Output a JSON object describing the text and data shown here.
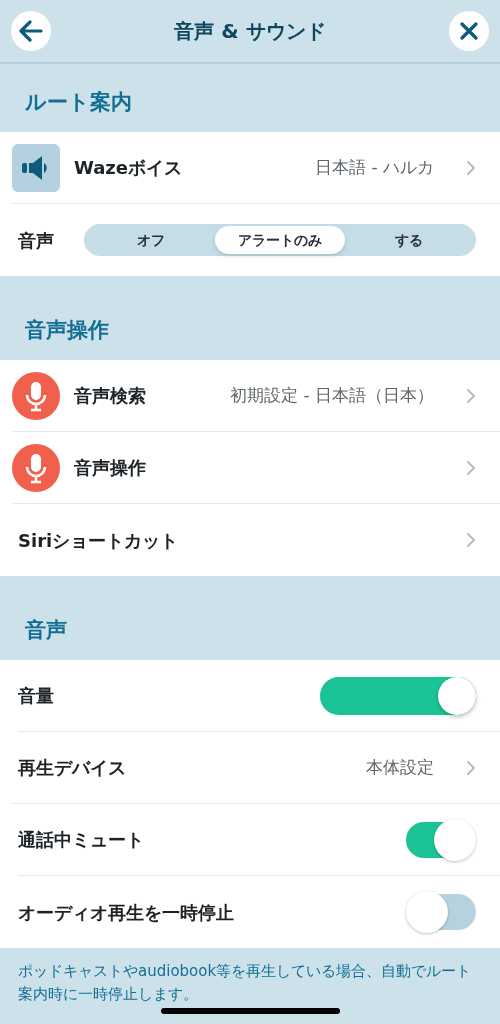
{
  "header": {
    "title": "音声 & サウンド"
  },
  "sections": [
    {
      "title": "ルート案内",
      "rows": [
        {
          "kind": "speaker",
          "label": "Wazeボイス",
          "value": "日本語 - ハルカ"
        },
        {
          "kind": "segmented",
          "label": "音声",
          "options": [
            {
              "label": "オフ",
              "selected": false
            },
            {
              "label": "アラートのみ",
              "selected": true
            },
            {
              "label": "する",
              "selected": false
            }
          ]
        }
      ]
    },
    {
      "title": "音声操作",
      "rows": [
        {
          "kind": "microphone",
          "label": "音声検索",
          "value": "初期設定 - 日本語（日本）"
        },
        {
          "kind": "microphone",
          "label": "音声操作"
        },
        {
          "kind": "nav",
          "label": "Siriショートカット"
        }
      ]
    },
    {
      "title": "音声",
      "rows": [
        {
          "kind": "slider",
          "label": "音量",
          "level": 1
        },
        {
          "kind": "nav",
          "label": "再生デバイス",
          "value": "本体設定"
        },
        {
          "kind": "toggle",
          "label": "通話中ミュート",
          "on": true
        },
        {
          "kind": "toggle",
          "label": "オーディオ再生を一時停止",
          "on": false
        }
      ]
    }
  ],
  "footer_note": "ポッドキャストやaudiobook等を再生している場合、自動でルート案内時に一時停止します。"
}
